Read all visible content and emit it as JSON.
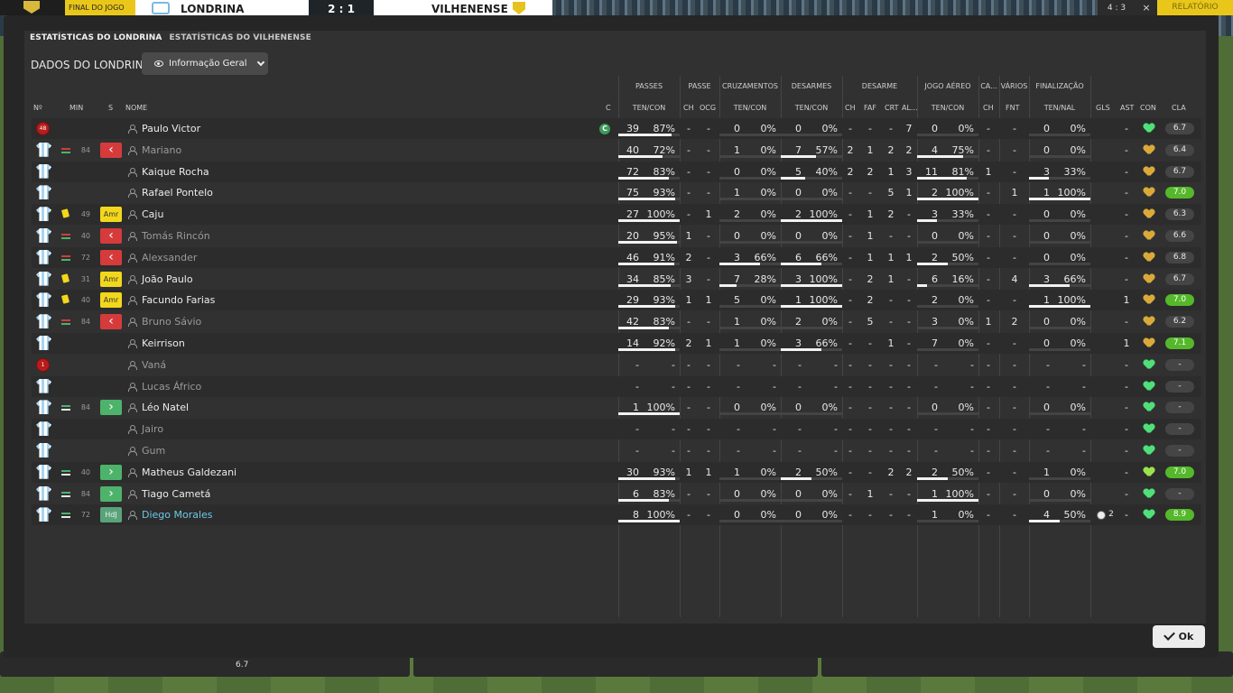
{
  "scoreboard": {
    "status": "FINAL DO JOGO",
    "home": "LONDRINA",
    "score": "2 : 1",
    "away": "VILHENENSE",
    "right_score": "4 : 3",
    "close": "×",
    "right_label": "RELATÓRIO"
  },
  "tabs": [
    {
      "label": "ESTATÍSTICAS DO LONDRINA",
      "active": true
    },
    {
      "label": "ESTATÍSTICAS DO VILHENENSE",
      "active": false
    }
  ],
  "section_label": "DADOS DO LONDRINA",
  "view_selector": "Informação Geral",
  "group_headers": {
    "passes": "PASSES",
    "passe": "PASSE",
    "cruzamentos": "CRUZAMENTOS",
    "desarmes": "DESARMES",
    "desarme": "DESARME",
    "jogo_aereo": "JOGO AÉREO",
    "ca": "CA...",
    "varios": "VÁRIOS",
    "finalizacao": "FINALIZAÇÃO"
  },
  "column_headers": {
    "no": "Nº",
    "min": "MIN",
    "s": "S",
    "nome": "NOME",
    "c": "C",
    "passes": "TEN/CON",
    "passe_ch": "CH",
    "passe_ocg": "OCG",
    "cruz": "TEN/CON",
    "des": "TEN/CON",
    "d_ch": "CH",
    "d_faf": "FAF",
    "d_crt": "CRT",
    "d_al": "AL...",
    "aereo": "TEN/CON",
    "ca_ch": "CH",
    "fnt": "FNT",
    "fin": "TEN/NAL",
    "gls": "GLS",
    "ast": "AST",
    "con": "CON",
    "cla": "CLA"
  },
  "players": [
    {
      "shirt": "gk",
      "num": "48",
      "sub": "",
      "min": "",
      "badge": "",
      "name": "Paulo Victor",
      "dim": false,
      "captain": true,
      "pas": [
        "39",
        "87%"
      ],
      "pbar": 0.87,
      "pch": "-",
      "pocg": "-",
      "cru": [
        "0",
        "0%"
      ],
      "cbar": 0,
      "des": [
        "0",
        "0%"
      ],
      "dbar": 0,
      "dch": "-",
      "faf": "-",
      "crt": "-",
      "al": "7",
      "aer": [
        "0",
        "0%"
      ],
      "abar": 0,
      "cach": "-",
      "fnt": "-",
      "fin": [
        "0",
        "0%"
      ],
      "fbar": 0,
      "gls": "",
      "ast": "-",
      "con": "green",
      "cla": "6.7",
      "good": false
    },
    {
      "shirt": "field",
      "num": "",
      "sub": "out",
      "min": "84",
      "badge": "red",
      "name": "Mariano",
      "dim": true,
      "captain": false,
      "pas": [
        "40",
        "72%"
      ],
      "pbar": 0.72,
      "pch": "-",
      "pocg": "-",
      "cru": [
        "1",
        "0%"
      ],
      "cbar": 0,
      "des": [
        "7",
        "57%"
      ],
      "dbar": 0.57,
      "dch": "2",
      "faf": "1",
      "crt": "2",
      "al": "2",
      "aer": [
        "4",
        "75%"
      ],
      "abar": 0.75,
      "cach": "-",
      "fnt": "-",
      "fin": [
        "0",
        "0%"
      ],
      "fbar": 0,
      "gls": "",
      "ast": "-",
      "con": "gold",
      "cla": "6.4",
      "good": false
    },
    {
      "shirt": "field",
      "num": "",
      "sub": "",
      "min": "",
      "badge": "",
      "name": "Kaique Rocha",
      "dim": false,
      "captain": false,
      "pas": [
        "72",
        "83%"
      ],
      "pbar": 0.83,
      "pch": "-",
      "pocg": "-",
      "cru": [
        "0",
        "0%"
      ],
      "cbar": 0,
      "des": [
        "5",
        "40%"
      ],
      "dbar": 0.4,
      "dch": "2",
      "faf": "2",
      "crt": "1",
      "al": "3",
      "aer": [
        "11",
        "81%"
      ],
      "abar": 0.81,
      "cach": "1",
      "fnt": "-",
      "fin": [
        "3",
        "33%"
      ],
      "fbar": 0.33,
      "gls": "",
      "ast": "-",
      "con": "gold",
      "cla": "6.7",
      "good": false
    },
    {
      "shirt": "field",
      "num": "",
      "sub": "",
      "min": "",
      "badge": "",
      "name": "Rafael Pontelo",
      "dim": false,
      "captain": false,
      "pas": [
        "75",
        "93%"
      ],
      "pbar": 0.93,
      "pch": "-",
      "pocg": "-",
      "cru": [
        "1",
        "0%"
      ],
      "cbar": 0,
      "des": [
        "0",
        "0%"
      ],
      "dbar": 0,
      "dch": "-",
      "faf": "-",
      "crt": "5",
      "al": "1",
      "aer": [
        "2",
        "100%"
      ],
      "abar": 1,
      "cach": "-",
      "fnt": "1",
      "fin": [
        "1",
        "100%"
      ],
      "fbar": 1,
      "gls": "",
      "ast": "-",
      "con": "gold",
      "cla": "7.0",
      "good": true
    },
    {
      "shirt": "field",
      "num": "",
      "sub": "yellow",
      "min": "49",
      "badge": "amr",
      "name": "Caju",
      "dim": false,
      "captain": false,
      "pas": [
        "27",
        "100%"
      ],
      "pbar": 1,
      "pch": "-",
      "pocg": "1",
      "cru": [
        "2",
        "0%"
      ],
      "cbar": 0,
      "des": [
        "2",
        "100%"
      ],
      "dbar": 1,
      "dch": "-",
      "faf": "1",
      "crt": "2",
      "al": "-",
      "aer": [
        "3",
        "33%"
      ],
      "abar": 0.33,
      "cach": "-",
      "fnt": "-",
      "fin": [
        "0",
        "0%"
      ],
      "fbar": 0,
      "gls": "",
      "ast": "-",
      "con": "gold",
      "cla": "6.3",
      "good": false
    },
    {
      "shirt": "field",
      "num": "",
      "sub": "out",
      "min": "40",
      "badge": "red",
      "name": "Tomás Rincón",
      "dim": true,
      "captain": false,
      "pas": [
        "20",
        "95%"
      ],
      "pbar": 0.95,
      "pch": "1",
      "pocg": "-",
      "cru": [
        "0",
        "0%"
      ],
      "cbar": 0,
      "des": [
        "0",
        "0%"
      ],
      "dbar": 0,
      "dch": "-",
      "faf": "1",
      "crt": "-",
      "al": "-",
      "aer": [
        "0",
        "0%"
      ],
      "abar": 0,
      "cach": "-",
      "fnt": "-",
      "fin": [
        "0",
        "0%"
      ],
      "fbar": 0,
      "gls": "",
      "ast": "-",
      "con": "gold",
      "cla": "6.6",
      "good": false
    },
    {
      "shirt": "field",
      "num": "",
      "sub": "out",
      "min": "72",
      "badge": "red",
      "name": "Alexsander",
      "dim": true,
      "captain": false,
      "pas": [
        "46",
        "91%"
      ],
      "pbar": 0.91,
      "pch": "2",
      "pocg": "-",
      "cru": [
        "3",
        "66%"
      ],
      "cbar": 0.66,
      "des": [
        "6",
        "66%"
      ],
      "dbar": 0.66,
      "dch": "-",
      "faf": "1",
      "crt": "1",
      "al": "1",
      "aer": [
        "2",
        "50%"
      ],
      "abar": 0.5,
      "cach": "-",
      "fnt": "-",
      "fin": [
        "0",
        "0%"
      ],
      "fbar": 0,
      "gls": "",
      "ast": "-",
      "con": "gold",
      "cla": "6.8",
      "good": false
    },
    {
      "shirt": "field",
      "num": "",
      "sub": "yellow",
      "min": "31",
      "badge": "amr",
      "name": "João Paulo",
      "dim": false,
      "captain": false,
      "pas": [
        "34",
        "85%"
      ],
      "pbar": 0.85,
      "pch": "3",
      "pocg": "-",
      "cru": [
        "7",
        "28%"
      ],
      "cbar": 0.28,
      "des": [
        "3",
        "100%"
      ],
      "dbar": 1,
      "dch": "-",
      "faf": "2",
      "crt": "1",
      "al": "-",
      "aer": [
        "6",
        "16%"
      ],
      "abar": 0.16,
      "cach": "-",
      "fnt": "4",
      "fin": [
        "3",
        "66%"
      ],
      "fbar": 0.66,
      "gls": "",
      "ast": "-",
      "con": "gold",
      "cla": "6.7",
      "good": false
    },
    {
      "shirt": "field",
      "num": "",
      "sub": "yellow",
      "min": "40",
      "badge": "amr",
      "name": "Facundo Farias",
      "dim": false,
      "captain": false,
      "pas": [
        "29",
        "93%"
      ],
      "pbar": 0.93,
      "pch": "1",
      "pocg": "1",
      "cru": [
        "5",
        "0%"
      ],
      "cbar": 0,
      "des": [
        "1",
        "100%"
      ],
      "dbar": 1,
      "dch": "-",
      "faf": "2",
      "crt": "-",
      "al": "-",
      "aer": [
        "2",
        "0%"
      ],
      "abar": 0,
      "cach": "-",
      "fnt": "-",
      "fin": [
        "1",
        "100%"
      ],
      "fbar": 1,
      "gls": "",
      "ast": "1",
      "con": "gold",
      "cla": "7.0",
      "good": true
    },
    {
      "shirt": "field",
      "num": "",
      "sub": "out",
      "min": "84",
      "badge": "red",
      "name": "Bruno Sávio",
      "dim": true,
      "captain": false,
      "pas": [
        "42",
        "83%"
      ],
      "pbar": 0.83,
      "pch": "-",
      "pocg": "-",
      "cru": [
        "1",
        "0%"
      ],
      "cbar": 0,
      "des": [
        "2",
        "0%"
      ],
      "dbar": 0,
      "dch": "-",
      "faf": "5",
      "crt": "-",
      "al": "-",
      "aer": [
        "3",
        "0%"
      ],
      "abar": 0,
      "cach": "1",
      "fnt": "2",
      "fin": [
        "0",
        "0%"
      ],
      "fbar": 0,
      "gls": "",
      "ast": "-",
      "con": "gold",
      "cla": "6.2",
      "good": false
    },
    {
      "shirt": "field",
      "num": "",
      "sub": "",
      "min": "",
      "badge": "",
      "name": "Keirrison",
      "dim": false,
      "captain": false,
      "pas": [
        "14",
        "92%"
      ],
      "pbar": 0.92,
      "pch": "2",
      "pocg": "1",
      "cru": [
        "1",
        "0%"
      ],
      "cbar": 0,
      "des": [
        "3",
        "66%"
      ],
      "dbar": 0.66,
      "dch": "-",
      "faf": "-",
      "crt": "1",
      "al": "-",
      "aer": [
        "7",
        "0%"
      ],
      "abar": 0,
      "cach": "-",
      "fnt": "-",
      "fin": [
        "0",
        "0%"
      ],
      "fbar": 0,
      "gls": "",
      "ast": "1",
      "con": "gold",
      "cla": "7.1",
      "good": true
    },
    {
      "shirt": "gk",
      "num": "1",
      "sub": "",
      "min": "",
      "badge": "",
      "name": "Vaná",
      "dim": true,
      "captain": false,
      "pas": [
        "-",
        "-"
      ],
      "pbar": null,
      "pch": "-",
      "pocg": "-",
      "cru": [
        "-",
        "-"
      ],
      "cbar": null,
      "des": [
        "-",
        "-"
      ],
      "dbar": null,
      "dch": "-",
      "faf": "-",
      "crt": "-",
      "al": "-",
      "aer": [
        "-",
        "-"
      ],
      "abar": null,
      "cach": "-",
      "fnt": "-",
      "fin": [
        "-",
        "-"
      ],
      "fbar": null,
      "gls": "",
      "ast": "-",
      "con": "green",
      "cla": "-",
      "good": false
    },
    {
      "shirt": "field",
      "num": "",
      "sub": "",
      "min": "",
      "badge": "",
      "name": "Lucas Áfrico",
      "dim": true,
      "captain": false,
      "pas": [
        "-",
        "-"
      ],
      "pbar": null,
      "pch": "-",
      "pocg": "-",
      "cru": [
        "-",
        "-"
      ],
      "cbar": null,
      "des": [
        "-",
        "-"
      ],
      "dbar": null,
      "dch": "-",
      "faf": "-",
      "crt": "-",
      "al": "-",
      "aer": [
        "-",
        "-"
      ],
      "abar": null,
      "cach": "-",
      "fnt": "-",
      "fin": [
        "-",
        "-"
      ],
      "fbar": null,
      "gls": "",
      "ast": "-",
      "con": "green",
      "cla": "-",
      "good": false
    },
    {
      "shirt": "field",
      "num": "",
      "sub": "in",
      "min": "84",
      "badge": "green",
      "name": "Léo Natel",
      "dim": false,
      "captain": false,
      "pas": [
        "1",
        "100%"
      ],
      "pbar": 1,
      "pch": "-",
      "pocg": "-",
      "cru": [
        "0",
        "0%"
      ],
      "cbar": 0,
      "des": [
        "0",
        "0%"
      ],
      "dbar": 0,
      "dch": "-",
      "faf": "-",
      "crt": "-",
      "al": "-",
      "aer": [
        "0",
        "0%"
      ],
      "abar": 0,
      "cach": "-",
      "fnt": "-",
      "fin": [
        "0",
        "0%"
      ],
      "fbar": 0,
      "gls": "",
      "ast": "-",
      "con": "green",
      "cla": "-",
      "good": false
    },
    {
      "shirt": "field",
      "num": "",
      "sub": "",
      "min": "",
      "badge": "",
      "name": "Jairo",
      "dim": true,
      "captain": false,
      "pas": [
        "-",
        "-"
      ],
      "pbar": null,
      "pch": "-",
      "pocg": "-",
      "cru": [
        "-",
        "-"
      ],
      "cbar": null,
      "des": [
        "-",
        "-"
      ],
      "dbar": null,
      "dch": "-",
      "faf": "-",
      "crt": "-",
      "al": "-",
      "aer": [
        "-",
        "-"
      ],
      "abar": null,
      "cach": "-",
      "fnt": "-",
      "fin": [
        "-",
        "-"
      ],
      "fbar": null,
      "gls": "",
      "ast": "-",
      "con": "green",
      "cla": "-",
      "good": false
    },
    {
      "shirt": "field",
      "num": "",
      "sub": "",
      "min": "",
      "badge": "",
      "name": "Gum",
      "dim": true,
      "captain": false,
      "pas": [
        "-",
        "-"
      ],
      "pbar": null,
      "pch": "-",
      "pocg": "-",
      "cru": [
        "-",
        "-"
      ],
      "cbar": null,
      "des": [
        "-",
        "-"
      ],
      "dbar": null,
      "dch": "-",
      "faf": "-",
      "crt": "-",
      "al": "-",
      "aer": [
        "-",
        "-"
      ],
      "abar": null,
      "cach": "-",
      "fnt": "-",
      "fin": [
        "-",
        "-"
      ],
      "fbar": null,
      "gls": "",
      "ast": "-",
      "con": "green",
      "cla": "-",
      "good": false
    },
    {
      "shirt": "field",
      "num": "",
      "sub": "in",
      "min": "40",
      "badge": "green",
      "name": "Matheus Galdezani",
      "dim": false,
      "captain": false,
      "pas": [
        "30",
        "93%"
      ],
      "pbar": 0.93,
      "pch": "1",
      "pocg": "1",
      "cru": [
        "1",
        "0%"
      ],
      "cbar": 0,
      "des": [
        "2",
        "50%"
      ],
      "dbar": 0.5,
      "dch": "-",
      "faf": "-",
      "crt": "2",
      "al": "2",
      "aer": [
        "2",
        "50%"
      ],
      "abar": 0.5,
      "cach": "-",
      "fnt": "-",
      "fin": [
        "1",
        "0%"
      ],
      "fbar": 0,
      "gls": "",
      "ast": "-",
      "con": "lime",
      "cla": "7.0",
      "good": true
    },
    {
      "shirt": "field",
      "num": "",
      "sub": "in",
      "min": "84",
      "badge": "green",
      "name": "Tiago Cametá",
      "dim": false,
      "captain": false,
      "pas": [
        "6",
        "83%"
      ],
      "pbar": 0.83,
      "pch": "-",
      "pocg": "-",
      "cru": [
        "0",
        "0%"
      ],
      "cbar": 0,
      "des": [
        "0",
        "0%"
      ],
      "dbar": 0,
      "dch": "-",
      "faf": "1",
      "crt": "-",
      "al": "-",
      "aer": [
        "1",
        "100%"
      ],
      "abar": 1,
      "cach": "-",
      "fnt": "-",
      "fin": [
        "0",
        "0%"
      ],
      "fbar": 0,
      "gls": "",
      "ast": "-",
      "con": "green",
      "cla": "-",
      "good": false
    },
    {
      "shirt": "field",
      "num": "",
      "sub": "in",
      "min": "72",
      "badge": "hdj",
      "name": "Diego Morales",
      "dim": false,
      "hl": true,
      "captain": false,
      "pas": [
        "8",
        "100%"
      ],
      "pbar": 1,
      "pch": "-",
      "pocg": "-",
      "cru": [
        "0",
        "0%"
      ],
      "cbar": 0,
      "des": [
        "0",
        "0%"
      ],
      "dbar": 0,
      "dch": "-",
      "faf": "-",
      "crt": "-",
      "al": "-",
      "aer": [
        "1",
        "0%"
      ],
      "abar": 0,
      "cach": "-",
      "fnt": "-",
      "fin": [
        "4",
        "50%"
      ],
      "fbar": 0.5,
      "gls": "2",
      "ast": "-",
      "con": "green",
      "cla": "8.9",
      "good": true
    }
  ],
  "badges": {
    "amr": "Amr",
    "hdj": "HdJ",
    "red": "‹",
    "green": "›"
  },
  "captain_label": "C",
  "ok_label": "Ok",
  "bottom_rating": "6.7",
  "colors": {
    "accent_yellow": "#e9c71a",
    "good_rating": "#55b82a",
    "sub_out": "#d63b3b",
    "sub_in": "#4db36b",
    "highlight_name": "#6ec8e6"
  }
}
